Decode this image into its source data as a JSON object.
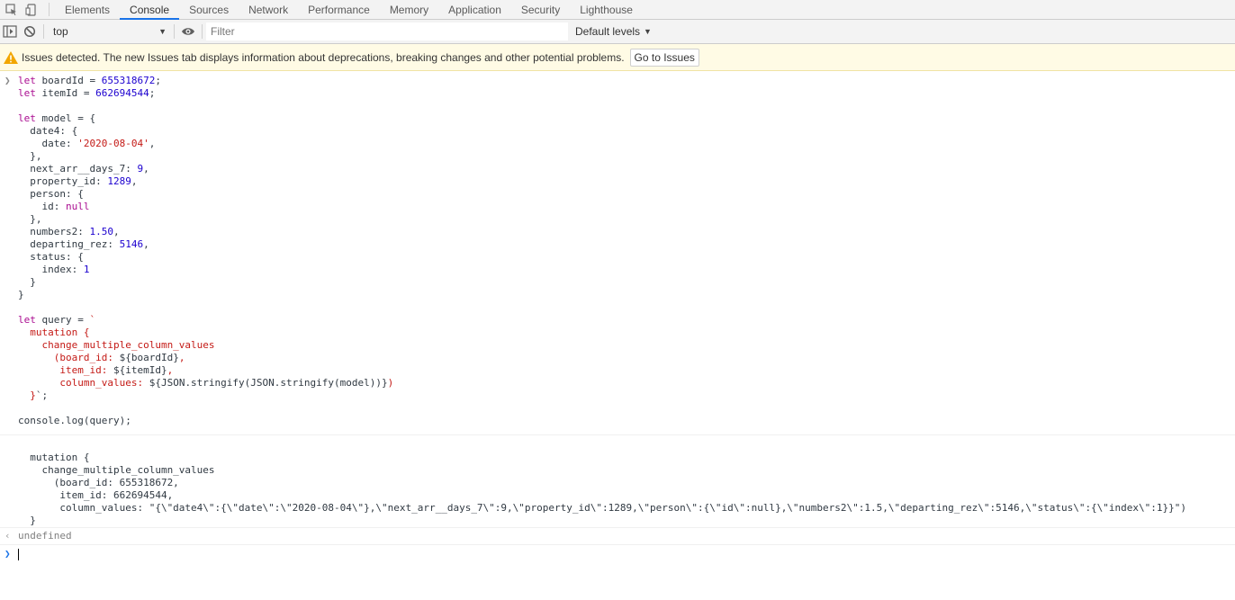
{
  "tabs": [
    {
      "label": "Elements",
      "active": false
    },
    {
      "label": "Console",
      "active": true
    },
    {
      "label": "Sources",
      "active": false
    },
    {
      "label": "Network",
      "active": false
    },
    {
      "label": "Performance",
      "active": false
    },
    {
      "label": "Memory",
      "active": false
    },
    {
      "label": "Application",
      "active": false
    },
    {
      "label": "Security",
      "active": false
    },
    {
      "label": "Lighthouse",
      "active": false
    }
  ],
  "toolbar": {
    "context": "top",
    "filter_placeholder": "Filter",
    "levels_label": "Default levels"
  },
  "banner": {
    "message": "Issues detected. The new Issues tab displays information about deprecations, breaking changes and other potential problems.",
    "button_label": "Go to Issues"
  },
  "input_code": [
    [
      [
        "kw",
        "let "
      ],
      [
        "plain",
        "boardId = "
      ],
      [
        "num",
        "655318672"
      ],
      [
        "plain",
        ";"
      ]
    ],
    [
      [
        "kw",
        "let "
      ],
      [
        "plain",
        "itemId = "
      ],
      [
        "num",
        "662694544"
      ],
      [
        "plain",
        ";"
      ]
    ],
    [],
    [
      [
        "kw",
        "let "
      ],
      [
        "plain",
        "model = {"
      ]
    ],
    [
      [
        "plain",
        "  date4: {"
      ]
    ],
    [
      [
        "plain",
        "    date: "
      ],
      [
        "str",
        "'2020-08-04'"
      ],
      [
        "plain",
        ","
      ]
    ],
    [
      [
        "plain",
        "  },"
      ]
    ],
    [
      [
        "plain",
        "  next_arr__days_7: "
      ],
      [
        "num",
        "9"
      ],
      [
        "plain",
        ","
      ]
    ],
    [
      [
        "plain",
        "  property_id: "
      ],
      [
        "num",
        "1289"
      ],
      [
        "plain",
        ","
      ]
    ],
    [
      [
        "plain",
        "  person: {"
      ]
    ],
    [
      [
        "plain",
        "    id: "
      ],
      [
        "kw",
        "null"
      ]
    ],
    [
      [
        "plain",
        "  },"
      ]
    ],
    [
      [
        "plain",
        "  numbers2: "
      ],
      [
        "num",
        "1.50"
      ],
      [
        "plain",
        ","
      ]
    ],
    [
      [
        "plain",
        "  departing_rez: "
      ],
      [
        "num",
        "5146"
      ],
      [
        "plain",
        ","
      ]
    ],
    [
      [
        "plain",
        "  status: {"
      ]
    ],
    [
      [
        "plain",
        "    index: "
      ],
      [
        "num",
        "1"
      ]
    ],
    [
      [
        "plain",
        "  }"
      ]
    ],
    [
      [
        "plain",
        "}"
      ]
    ],
    [],
    [
      [
        "kw",
        "let "
      ],
      [
        "plain",
        "query = "
      ],
      [
        "str",
        "`"
      ]
    ],
    [
      [
        "str",
        "  mutation {"
      ]
    ],
    [
      [
        "str",
        "    change_multiple_column_values"
      ]
    ],
    [
      [
        "str",
        "      (board_id: "
      ],
      [
        "plain",
        "${boardId}"
      ],
      [
        "str",
        ","
      ]
    ],
    [
      [
        "str",
        "       item_id: "
      ],
      [
        "plain",
        "${itemId}"
      ],
      [
        "str",
        ","
      ]
    ],
    [
      [
        "str",
        "       column_values: "
      ],
      [
        "plain",
        "${JSON.stringify(JSON.stringify(model))}"
      ],
      [
        "str",
        ")"
      ]
    ],
    [
      [
        "str",
        "  }"
      ],
      [
        "plain",
        "`;"
      ]
    ],
    [],
    [
      [
        "plain",
        "console.log(query);"
      ]
    ]
  ],
  "log_output": [
    "",
    "  mutation {",
    "    change_multiple_column_values",
    "      (board_id: 655318672,",
    "       item_id: 662694544,",
    "       column_values: \"{\\\"date4\\\":{\\\"date\\\":\\\"2020-08-04\\\"},\\\"next_arr__days_7\\\":9,\\\"property_id\\\":1289,\\\"person\\\":{\\\"id\\\":null},\\\"numbers2\\\":1.5,\\\"departing_rez\\\":5146,\\\"status\\\":{\\\"index\\\":1}}\")",
    "  }"
  ],
  "result": "undefined",
  "colors": {
    "keyword": "#aa0d91",
    "number": "#1c00cf",
    "string": "#c41a16",
    "tab_active_underline": "#1a73e8",
    "banner_bg": "#fffbe5"
  }
}
